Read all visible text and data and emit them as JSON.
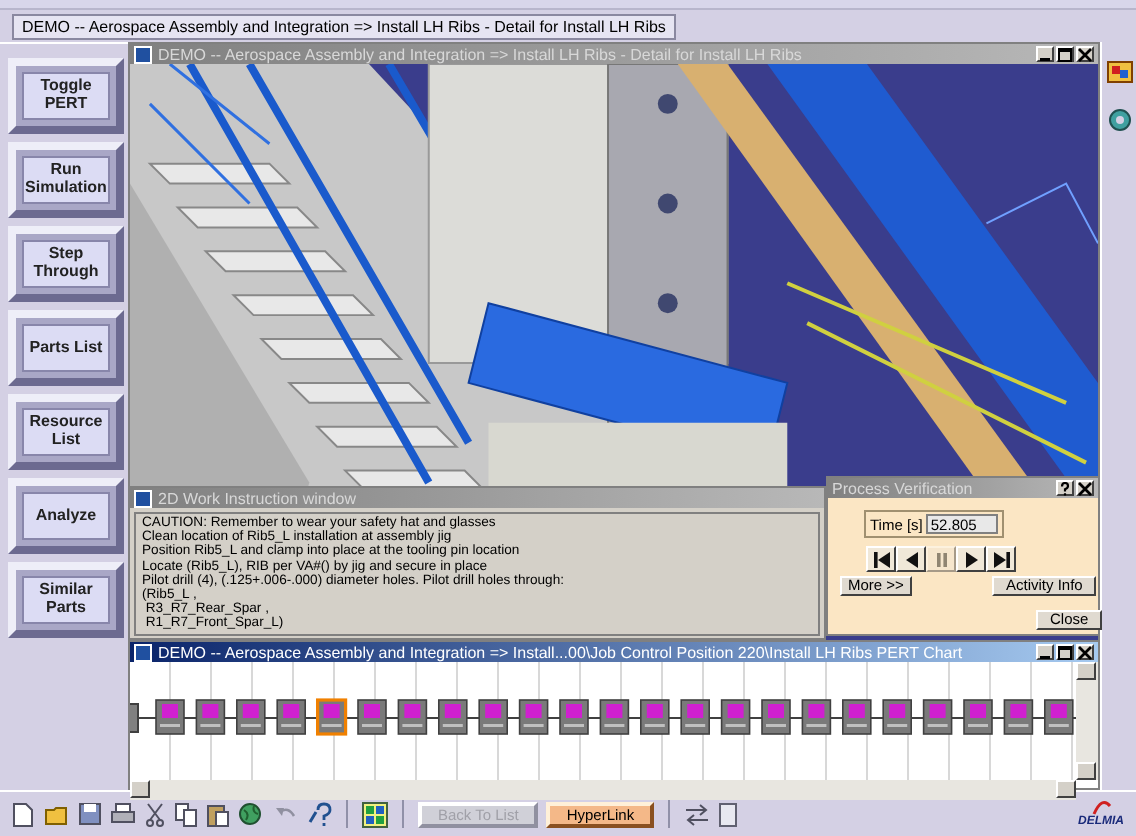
{
  "document_tab": {
    "label": "DEMO -- Aerospace Assembly and Integration => Install LH Ribs - Detail for Install LH Ribs"
  },
  "side_buttons": [
    {
      "label": "Toggle PERT"
    },
    {
      "label": "Run Simulation"
    },
    {
      "label": "Step Through"
    },
    {
      "label": "Parts List"
    },
    {
      "label": "Resource List"
    },
    {
      "label": "Analyze"
    },
    {
      "label": "Similar Parts"
    }
  ],
  "detail_window": {
    "title": "DEMO -- Aerospace Assembly and Integration => Install LH Ribs - Detail for Install LH Ribs",
    "active": false
  },
  "work_instruction_window": {
    "title": "2D Work Instruction window",
    "active": false,
    "lines": [
      "CAUTION: Remember to wear your safety hat and glasses",
      "Clean location of Rib5_L installation at assembly jig",
      "Position Rib5_L and clamp into place at the tooling pin location",
      "Locate (Rib5_L), RIB per VA#() by jig and secure in place",
      "Pilot drill (4), (.125+.006-.000) diameter holes. Pilot drill holes through:",
      "(Rib5_L ,",
      " R3_R7_Rear_Spar ,",
      " R1_R7_Front_Spar_L)"
    ]
  },
  "process_verification": {
    "title": "Process Verification",
    "active": false,
    "time_label": "Time [s]",
    "time_value": "52.805",
    "transport": [
      {
        "kind": "first",
        "disabled": false
      },
      {
        "kind": "back",
        "disabled": false
      },
      {
        "kind": "pause",
        "disabled": true
      },
      {
        "kind": "play",
        "disabled": false
      },
      {
        "kind": "last",
        "disabled": false
      }
    ],
    "more_button": "More >>",
    "activity_button": "Activity Info",
    "close_button": "Close"
  },
  "pert_window": {
    "title": "DEMO -- Aerospace Assembly and Integration => Install...00\\Job Control Position 220\\Install LH Ribs PERT Chart",
    "active": true,
    "nodes": [
      {
        "selected": false
      },
      {
        "selected": false
      },
      {
        "selected": false
      },
      {
        "selected": false
      },
      {
        "selected": true
      },
      {
        "selected": false
      },
      {
        "selected": false
      },
      {
        "selected": false
      },
      {
        "selected": false
      },
      {
        "selected": false
      },
      {
        "selected": false
      },
      {
        "selected": false
      },
      {
        "selected": false
      },
      {
        "selected": false
      },
      {
        "selected": false
      },
      {
        "selected": false
      },
      {
        "selected": false
      },
      {
        "selected": false
      },
      {
        "selected": false
      },
      {
        "selected": false
      },
      {
        "selected": false
      },
      {
        "selected": false
      },
      {
        "selected": false
      }
    ]
  },
  "bottom_toolbar": {
    "buttons": [
      {
        "label": "Back To List",
        "disabled": true
      },
      {
        "label": "HyperLink",
        "disabled": false
      }
    ],
    "logo_text": "DELMIA"
  }
}
